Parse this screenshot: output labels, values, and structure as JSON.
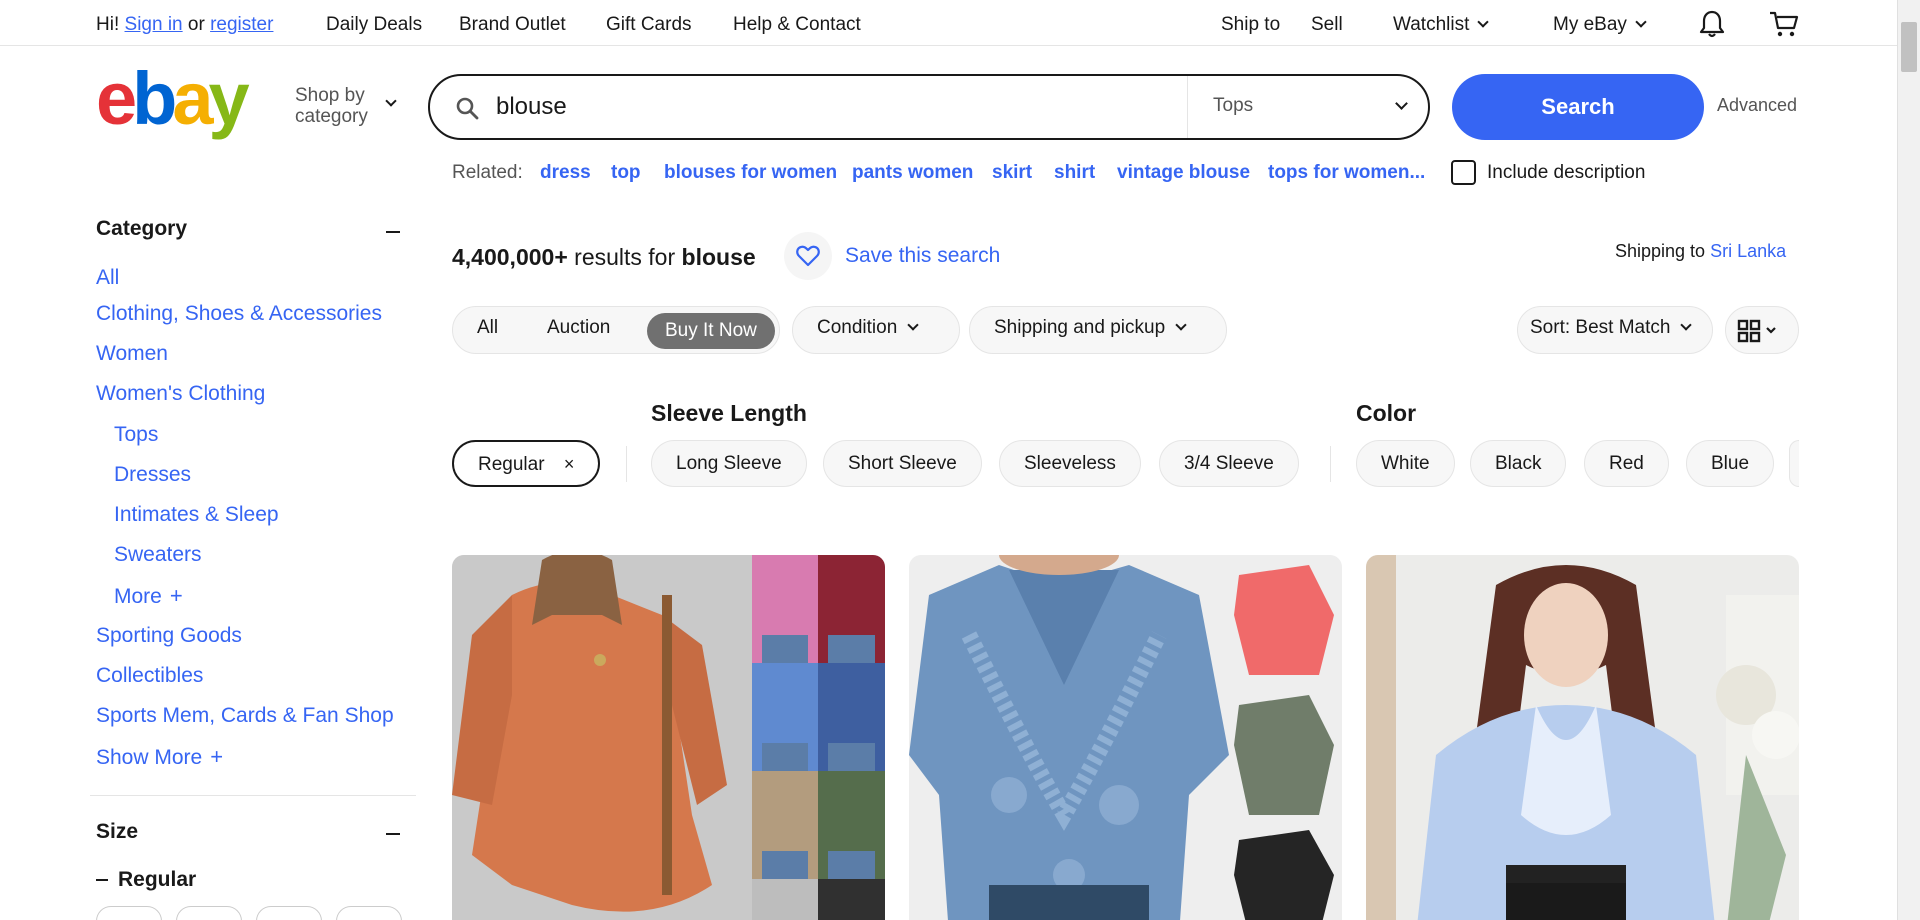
{
  "topbar": {
    "greeting": "Hi!",
    "sign_in": "Sign in",
    "or": "or",
    "register": "register",
    "daily_deals": "Daily Deals",
    "brand_outlet": "Brand Outlet",
    "gift_cards": "Gift Cards",
    "help_contact": "Help & Contact",
    "ship_to": "Ship to",
    "sell": "Sell",
    "watchlist": "Watchlist",
    "my_ebay": "My eBay",
    "icons": [
      "bell-icon",
      "cart-icon"
    ]
  },
  "header": {
    "shop_by_line1": "Shop by",
    "shop_by_line2": "category",
    "search_value": "blouse",
    "category_select": "Tops",
    "search_button": "Search",
    "advanced": "Advanced"
  },
  "related": {
    "label": "Related:",
    "links": [
      "dress",
      "top",
      "blouses for women",
      "pants women",
      "skirt",
      "shirt",
      "vintage blouse",
      "tops for women..."
    ],
    "include_description": "Include description"
  },
  "sidebar": {
    "category_title": "Category",
    "categories": [
      "All",
      "Clothing, Shoes & Accessories",
      "Women",
      "Women's Clothing"
    ],
    "subcategories": [
      "Tops",
      "Dresses",
      "Intimates & Sleep",
      "Sweaters"
    ],
    "more": "More",
    "other_categories": [
      "Sporting Goods",
      "Collectibles",
      "Sports Mem, Cards & Fan Shop"
    ],
    "show_more": "Show More",
    "size_title": "Size",
    "size_sub": "Regular"
  },
  "results": {
    "count": "4,400,000+",
    "results_for": "results for",
    "query": "blouse",
    "save_search": "Save this search",
    "shipping_to": "Shipping to",
    "location": "Sri Lanka"
  },
  "filters": {
    "format_tabs": [
      "All",
      "Auction",
      "Buy It Now"
    ],
    "active_tab": "Buy It Now",
    "condition": "Condition",
    "shipping_pickup": "Shipping and pickup",
    "sort": "Sort: Best Match"
  },
  "aspects": {
    "sleeve_length_title": "Sleeve Length",
    "color_title": "Color",
    "selected_chip": "Regular",
    "sleeve_options": [
      "Long Sleeve",
      "Short Sleeve",
      "Sleeveless",
      "3/4 Sleeve"
    ],
    "color_options": [
      "White",
      "Black",
      "Red",
      "Blue"
    ]
  },
  "colors": {
    "accent": "#3665f3",
    "text": "#191919",
    "muted": "#555555",
    "ebay_e": "#e53238",
    "ebay_b": "#0064d2",
    "ebay_a": "#f5af02",
    "ebay_y": "#86b817"
  }
}
